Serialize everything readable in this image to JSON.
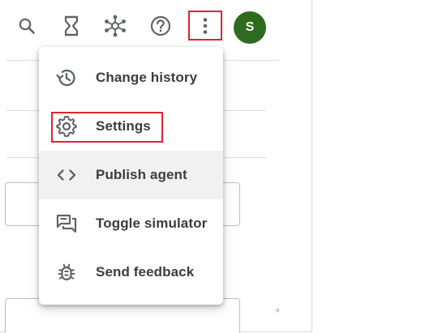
{
  "toolbar": {
    "icons": [
      "search-icon",
      "hourglass-icon",
      "network-icon",
      "help-icon",
      "more-vert-icon"
    ],
    "avatar_letter": "S",
    "avatar_color": "#2e6b1f",
    "highlight_color": "#e0242b"
  },
  "menu": {
    "items": [
      {
        "label": "Change history",
        "icon": "history-icon"
      },
      {
        "label": "Settings",
        "icon": "settings-icon"
      },
      {
        "label": "Publish agent",
        "icon": "code-icon"
      },
      {
        "label": "Toggle simulator",
        "icon": "chat-icon"
      },
      {
        "label": "Send feedback",
        "icon": "bug-icon"
      }
    ]
  }
}
